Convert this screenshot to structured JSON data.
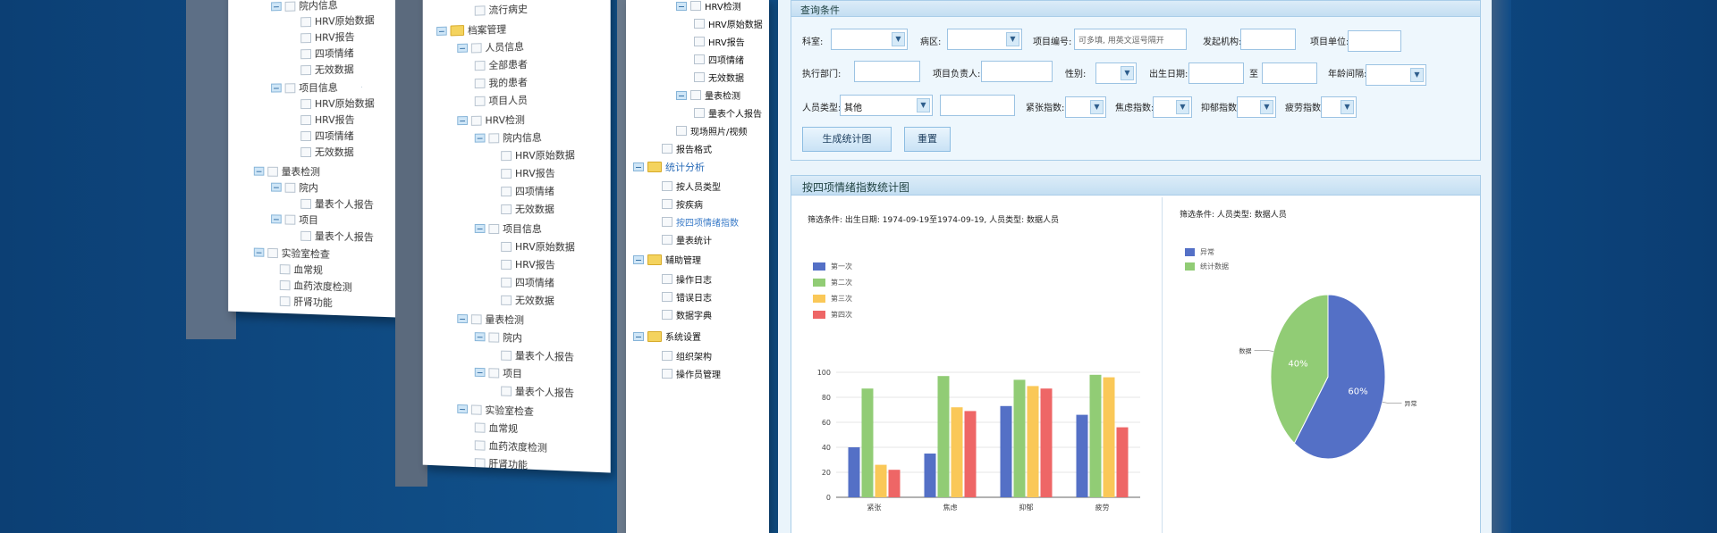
{
  "colors": {
    "s1": "#5470c6",
    "s2": "#91cc75",
    "s3": "#fac858",
    "s4": "#ee6666"
  },
  "panel1": {
    "items": [
      "院内信息",
      "HRV原始数据",
      "HRV报告",
      "四项情绪",
      "无效数据",
      "项目信息",
      "HRV原始数据",
      "HRV报告",
      "四项情绪",
      "无效数据",
      "量表检测",
      "院内",
      "量表个人报告",
      "项目",
      "量表个人报告",
      "实验室检查",
      "血常规",
      "血药浓度检测",
      "肝肾功能"
    ]
  },
  "panel2": {
    "items": [
      "流行病史",
      "档案管理",
      "人员信息",
      "全部患者",
      "我的患者",
      "项目人员",
      "HRV检测",
      "院内信息",
      "HRV原始数据",
      "HRV报告",
      "四项情绪",
      "无效数据",
      "项目信息",
      "HRV原始数据",
      "HRV报告",
      "四项情绪",
      "无效数据",
      "量表检测",
      "院内",
      "量表个人报告",
      "项目",
      "量表个人报告",
      "实验室检查",
      "血常规",
      "血药浓度检测",
      "肝肾功能"
    ]
  },
  "panel3": {
    "items": [
      "HRV检测",
      "HRV原始数据",
      "HRV报告",
      "四项情绪",
      "无效数据",
      "量表检测",
      "量表个人报告",
      "现场照片/视频",
      "报告格式",
      "统计分析",
      "按人员类型",
      "按疾病",
      "按四项情绪指数",
      "量表统计",
      "辅助管理",
      "操作日志",
      "错误日志",
      "数据字典",
      "系统设置",
      "组织架构",
      "操作员管理"
    ]
  },
  "query": {
    "title": "查询条件",
    "dept_label": "科室:",
    "ward_label": "病区:",
    "project_no_label": "项目编号:",
    "project_no_placeholder": "可多填, 用英文逗号隔开",
    "issuer_label": "发起机构:",
    "project_unit_label": "项目单位:",
    "exec_dept_label": "执行部门:",
    "project_lead_label": "项目负责人:",
    "gender_label": "性别:",
    "birth_label": "出生日期:",
    "to_label": "至",
    "age_label": "年龄间隔:",
    "person_type_label": "人员类型:",
    "person_type_value": "其他",
    "tension_label": "紧张指数:",
    "anxiety_label": "焦虑指数:",
    "depress_label": "抑郁指数:",
    "fatigue_label": "疲劳指数:",
    "generate_btn": "生成统计图",
    "reset_btn": "重置"
  },
  "chart_panel": {
    "title": "按四项情绪指数统计图",
    "left_filter": "筛选条件: 出生日期: 1974-09-19至1974-09-19, 人员类型: 数据人员",
    "right_filter": "筛选条件: 人员类型: 数据人员"
  },
  "chart_data": [
    {
      "type": "bar",
      "categories": [
        "紧张",
        "焦虑",
        "抑郁",
        "疲劳"
      ],
      "series": [
        {
          "name": "第一次",
          "values": [
            40,
            35,
            73,
            66
          ]
        },
        {
          "name": "第二次",
          "values": [
            87,
            97,
            94,
            98
          ]
        },
        {
          "name": "第三次",
          "values": [
            26,
            72,
            89,
            96
          ]
        },
        {
          "name": "第四次",
          "values": [
            22,
            69,
            87,
            56
          ]
        }
      ],
      "ylim": [
        0,
        100
      ],
      "yticks": [
        "0",
        "20",
        "40",
        "60",
        "80",
        "100"
      ]
    },
    {
      "type": "pie",
      "labels": [
        "异常",
        "统计数据"
      ],
      "values": [
        60,
        40
      ],
      "percent_labels": [
        "60%",
        "40%"
      ],
      "legend": [
        "异常",
        "统计数据"
      ]
    }
  ]
}
